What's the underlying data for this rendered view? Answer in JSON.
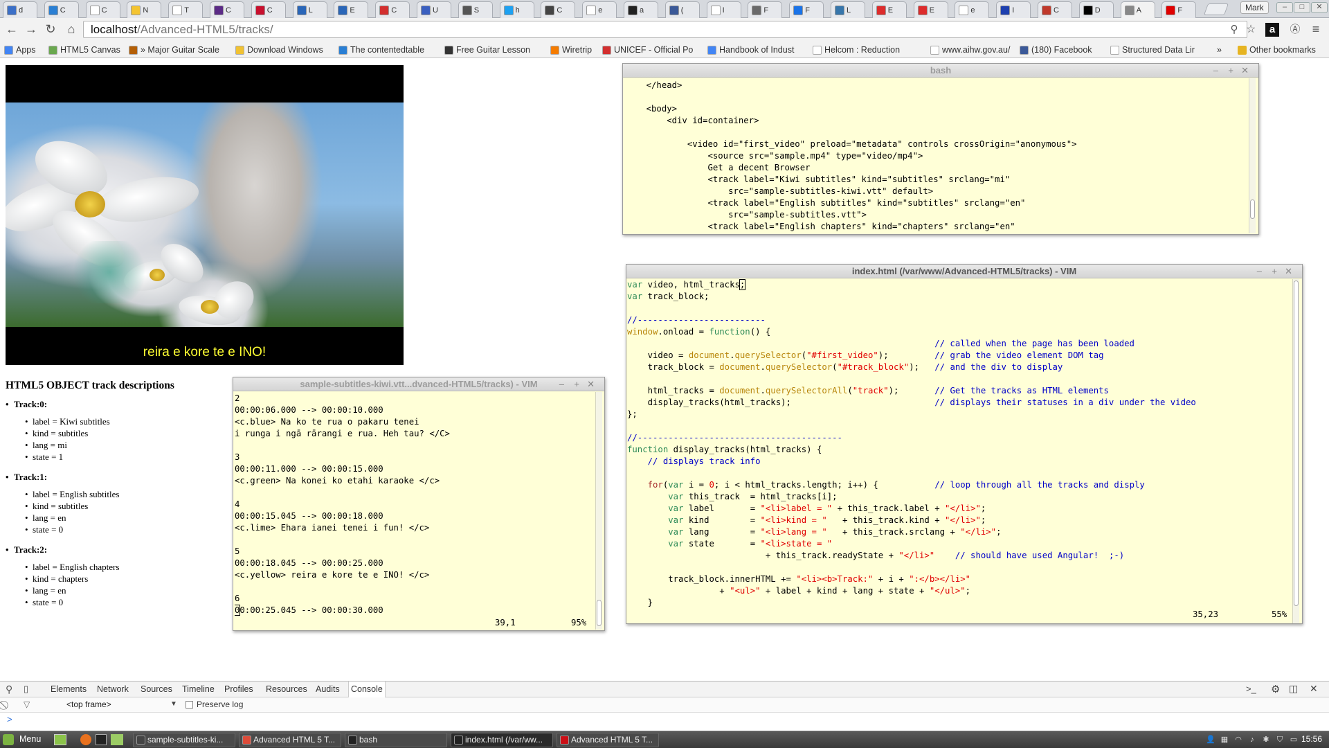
{
  "browser": {
    "tabs": [
      {
        "label": "d",
        "color": "#3b6fc7"
      },
      {
        "label": "C",
        "color": "#2a7fd4"
      },
      {
        "label": "C",
        "color": "#ffffff"
      },
      {
        "label": "N",
        "color": "#f4c430"
      },
      {
        "label": "T",
        "color": "#ffffff"
      },
      {
        "label": "C",
        "color": "#5b2a86"
      },
      {
        "label": "C",
        "color": "#c8102e"
      },
      {
        "label": "L",
        "color": "#2a66b8"
      },
      {
        "label": "E",
        "color": "#2a66b8"
      },
      {
        "label": "C",
        "color": "#d32f2f"
      },
      {
        "label": "U",
        "color": "#3a5fc0"
      },
      {
        "label": "S",
        "color": "#555555"
      },
      {
        "label": "h",
        "color": "#1da1f2"
      },
      {
        "label": "C",
        "color": "#444444"
      },
      {
        "label": "e",
        "color": "#ffffff"
      },
      {
        "label": "a",
        "color": "#222222"
      },
      {
        "label": "(",
        "color": "#3b5998"
      },
      {
        "label": "I",
        "color": "#ffffff"
      },
      {
        "label": "F",
        "color": "#6a6a6a"
      },
      {
        "label": "F",
        "color": "#1a73e8"
      },
      {
        "label": "L",
        "color": "#3776ab"
      },
      {
        "label": "E",
        "color": "#dd2c2c"
      },
      {
        "label": "E",
        "color": "#dd2c2c"
      },
      {
        "label": "e",
        "color": "#ffffff"
      },
      {
        "label": "I",
        "color": "#1e40af"
      },
      {
        "label": "C",
        "color": "#c0392b"
      },
      {
        "label": "D",
        "color": "#000000"
      },
      {
        "label": "A",
        "color": "#888888"
      },
      {
        "label": "F",
        "color": "#e00000"
      }
    ],
    "user_name": "Mark",
    "url_host": "localhost",
    "url_path": "/Advanced-HTML5/tracks/",
    "bookmarks": [
      {
        "label": "Apps",
        "color": "#4285f4"
      },
      {
        "label": "HTML5 Canvas",
        "color": "#6aa84f"
      },
      {
        "label": "» Major Guitar Scale",
        "color": "#b45f06"
      },
      {
        "label": "Download Windows",
        "color": "#f1c232"
      },
      {
        "label": "The contentedtable",
        "color": "#2a7fd4"
      },
      {
        "label": "Free Guitar Lesson",
        "color": "#333333"
      },
      {
        "label": "Wiretrip",
        "color": "#f57c00"
      },
      {
        "label": "UNICEF - Official Po",
        "color": "#d32f2f"
      },
      {
        "label": "Handbook of Indust",
        "color": "#4285f4"
      },
      {
        "label": "Helcom : Reduction",
        "color": "#ffffff"
      },
      {
        "label": "www.aihw.gov.au/",
        "color": "#ffffff"
      },
      {
        "label": "(180) Facebook",
        "color": "#3b5998"
      },
      {
        "label": "Structured Data Lir",
        "color": "#ffffff"
      }
    ],
    "bookmarks_more": "»",
    "other_bookmarks": "Other bookmarks"
  },
  "page": {
    "subtitle": "reira e kore te e INO!",
    "heading": "HTML5 OBJECT track descriptions",
    "tracks": [
      {
        "title": "Track:0:",
        "label": "label = Kiwi subtitles",
        "kind": "kind = subtitles",
        "lang": "lang = mi",
        "state": "state = 1"
      },
      {
        "title": "Track:1:",
        "label": "label = English subtitles",
        "kind": "kind = subtitles",
        "lang": "lang = en",
        "state": "state = 0"
      },
      {
        "title": "Track:2:",
        "label": "label = English chapters",
        "kind": "kind = chapters",
        "lang": "lang = en",
        "state": "state = 0"
      }
    ]
  },
  "bash_window": {
    "title": "bash",
    "lines": [
      "    </head>",
      "",
      "    <body>",
      "        <div id=container>",
      "",
      "            <video id=\"first_video\" preload=\"metadata\" controls crossOrigin=\"anonymous\">",
      "                <source src=\"sample.mp4\" type=\"video/mp4\">",
      "                Get a decent Browser",
      "                <track label=\"Kiwi subtitles\" kind=\"subtitles\" srclang=\"mi\"",
      "                    src=\"sample-subtitles-kiwi.vtt\" default>",
      "                <track label=\"English subtitles\" kind=\"subtitles\" srclang=\"en\"",
      "                    src=\"sample-subtitles.vtt\">",
      "                <track label=\"English chapters\" kind=\"chapters\" srclang=\"en\""
    ]
  },
  "vtt_window": {
    "title": "sample-subtitles-kiwi.vtt...dvanced-HTML5/tracks) - VIM",
    "lines": [
      "2",
      "00:00:06.000 --> 00:00:10.000",
      "<c.blue> Na ko te rua o pakaru tenei",
      "i runga i ngā rārangi e rua. Heh tau? </C>",
      "",
      "3",
      "00:00:11.000 --> 00:00:15.000",
      "<c.green> Na konei ko etahi karaoke </c>",
      "",
      "4",
      "00:00:15.045 --> 00:00:18.000",
      "<c.lime> Ehara ianei tenei i fun! </c>",
      "",
      "5",
      "00:00:18.045 --> 00:00:25.000",
      "<c.yellow> reira e kore te e INO! </c>",
      "",
      "6",
      "00:00:25.045 --> 00:00:30.000"
    ],
    "cursor_pos": "39,1",
    "scroll_pct": "95%"
  },
  "index_window": {
    "title": "index.html (/var/www/Advanced-HTML5/tracks) - VIM",
    "cursor_pos": "35,23",
    "scroll_pct": "55%"
  },
  "devtools": {
    "tabs": [
      "Elements",
      "Network",
      "Sources",
      "Timeline",
      "Profiles",
      "Resources",
      "Audits",
      "Console"
    ],
    "frame_selector": "<top frame>",
    "preserve_log": "Preserve log",
    "prompt": ">"
  },
  "taskbar": {
    "menu_label": "Menu",
    "tasks": [
      {
        "label": "sample-subtitles-ki...",
        "color": "#444444"
      },
      {
        "label": "Advanced HTML 5 T...",
        "color": "#dd4b39"
      },
      {
        "label": "bash",
        "color": "#222222"
      },
      {
        "label": "index.html (/var/ww...",
        "color": "#222222"
      },
      {
        "label": "Advanced HTML 5 T...",
        "color": "#cc0f16"
      }
    ],
    "clock": "15:56"
  }
}
